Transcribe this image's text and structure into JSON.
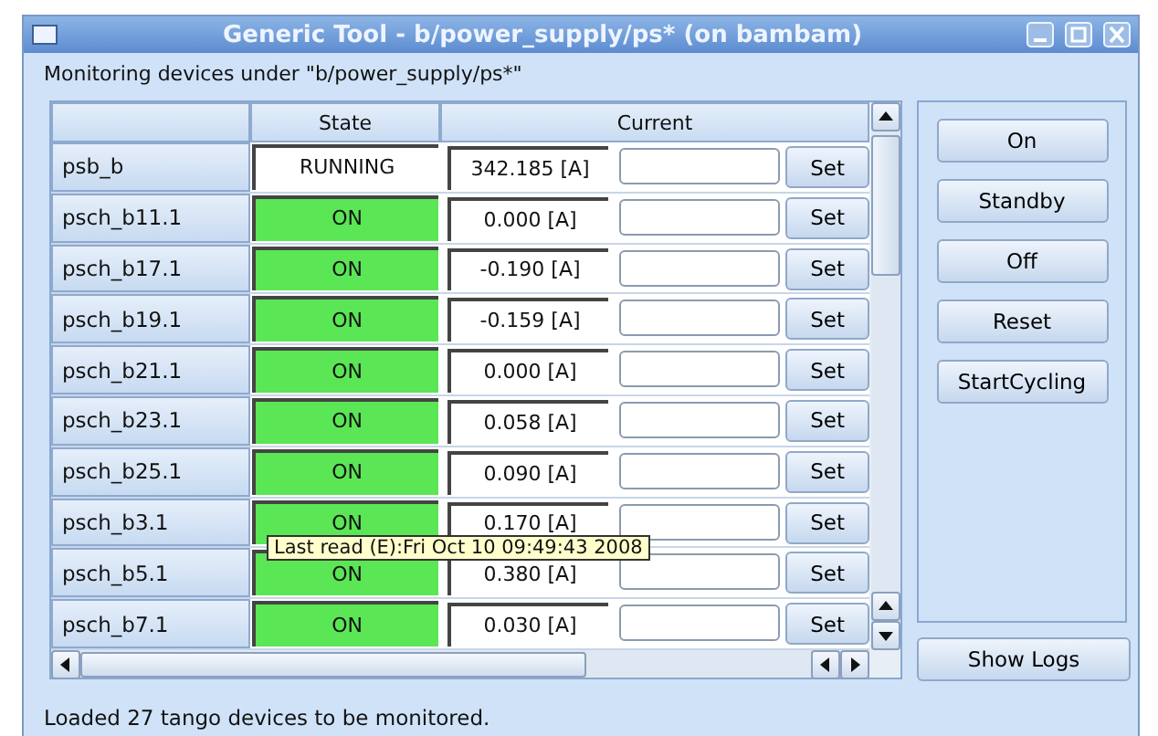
{
  "window": {
    "title": "Generic Tool - b/power_supply/ps* (on bambam)"
  },
  "heading": "Monitoring devices under \"b/power_supply/ps*\"",
  "table": {
    "columns": [
      "State",
      "Current"
    ],
    "rows": [
      {
        "name": "psb_b",
        "state": "RUNNING",
        "color": "#ffffff",
        "value": "342.185 [A]",
        "action": "Set"
      },
      {
        "name": "psch_b11.1",
        "state": "ON",
        "color": "#5ae655",
        "value": "0.000 [A]",
        "action": "Set"
      },
      {
        "name": "psch_b17.1",
        "state": "ON",
        "color": "#5ae655",
        "value": "-0.190 [A]",
        "action": "Set"
      },
      {
        "name": "psch_b19.1",
        "state": "ON",
        "color": "#5ae655",
        "value": "-0.159 [A]",
        "action": "Set"
      },
      {
        "name": "psch_b21.1",
        "state": "ON",
        "color": "#5ae655",
        "value": "0.000 [A]",
        "action": "Set"
      },
      {
        "name": "psch_b23.1",
        "state": "ON",
        "color": "#5ae655",
        "value": "0.058 [A]",
        "action": "Set"
      },
      {
        "name": "psch_b25.1",
        "state": "ON",
        "color": "#5ae655",
        "value": "0.090 [A]",
        "action": "Set"
      },
      {
        "name": "psch_b3.1",
        "state": "ON",
        "color": "#5ae655",
        "value": "0.170 [A]",
        "action": "Set"
      },
      {
        "name": "psch_b5.1",
        "state": "ON",
        "color": "#5ae655",
        "value": "0.380 [A]",
        "action": "Set"
      },
      {
        "name": "psch_b7.1",
        "state": "ON",
        "color": "#5ae655",
        "value": "0.030 [A]",
        "action": "Set"
      }
    ]
  },
  "tooltip": {
    "text": "Last read (E):Fri Oct 10 09:49:43 2008"
  },
  "commands": [
    "On",
    "Standby",
    "Off",
    "Reset",
    "StartCycling"
  ],
  "show_logs": "Show Logs",
  "status_bar": "Loaded 27 tango devices to be monitored."
}
